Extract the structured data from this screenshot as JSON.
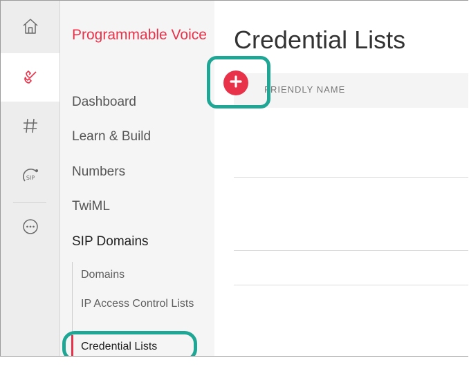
{
  "rail": {
    "items": [
      {
        "icon": "home-icon"
      },
      {
        "icon": "phone-icon",
        "active": true
      },
      {
        "icon": "hash-icon"
      },
      {
        "icon": "sip-icon",
        "label": "SIP"
      },
      {
        "icon": "more-icon"
      }
    ]
  },
  "nav": {
    "product_title": "Programmable Voice",
    "links": [
      "Dashboard",
      "Learn & Build",
      "Numbers",
      "TwiML",
      "SIP Domains"
    ],
    "sub_links": [
      "Domains",
      "IP Access Control Lists",
      "Credential Lists"
    ],
    "active_sub": "Credential Lists"
  },
  "main": {
    "title": "Credential Lists",
    "add_icon": "plus-icon",
    "columns": [
      "FRIENDLY NAME"
    ]
  },
  "colors": {
    "accent": "#e8324a",
    "highlight": "#1fa694",
    "rail_bg": "#ededed",
    "nav_bg": "#f5f5f5"
  }
}
